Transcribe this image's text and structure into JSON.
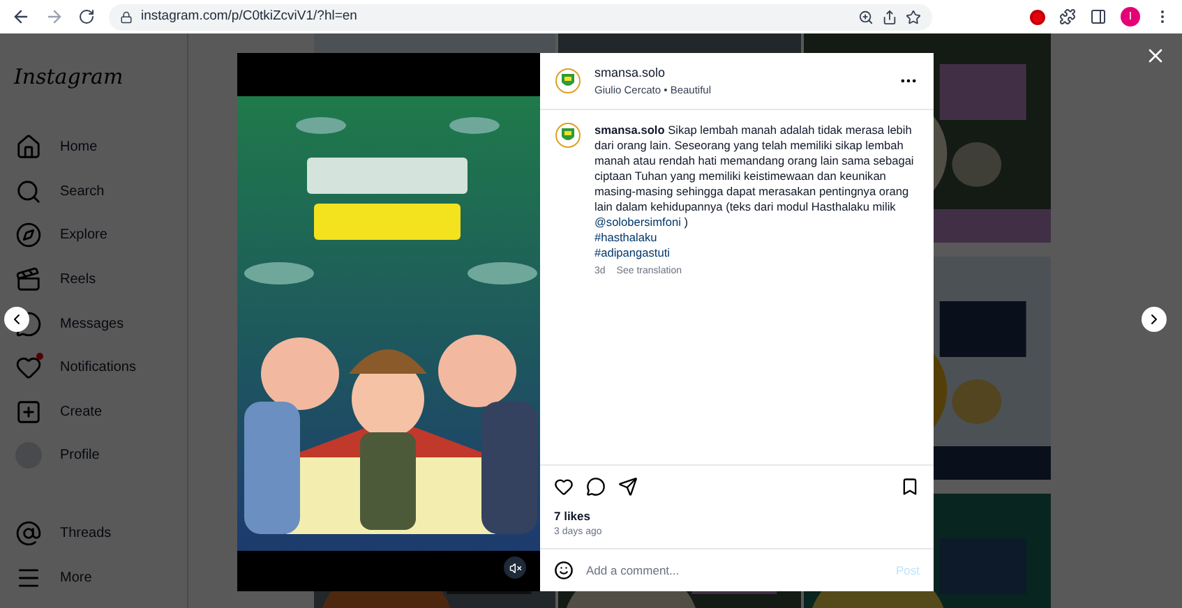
{
  "browser": {
    "url": "instagram.com/p/C0tkiZcviV1/?hl=en",
    "profile_initial": "I"
  },
  "sidebar": {
    "logo": "Instagram",
    "items": [
      {
        "label": "Home",
        "kind": "home",
        "badge": false
      },
      {
        "label": "Search",
        "kind": "search",
        "badge": false
      },
      {
        "label": "Explore",
        "kind": "explore",
        "badge": false
      },
      {
        "label": "Reels",
        "kind": "reels",
        "badge": false
      },
      {
        "label": "Messages",
        "kind": "messages",
        "badge": false
      },
      {
        "label": "Notifications",
        "kind": "notifications",
        "badge": true
      },
      {
        "label": "Create",
        "kind": "create",
        "badge": false
      },
      {
        "label": "Profile",
        "kind": "profile",
        "badge": false
      }
    ],
    "bottom_items": [
      {
        "label": "Threads",
        "kind": "threads",
        "badge": false
      },
      {
        "label": "More",
        "kind": "more",
        "badge": false
      }
    ]
  },
  "post": {
    "media": {
      "kind": "picture",
      "muted": true
    },
    "username": "smansa.solo",
    "audio": "Giulio Cercato • Beautiful",
    "caption": {
      "username": "smansa.solo",
      "text": "Sikap lembah manah adalah tidak merasa lebih dari orang lain. Seseorang yang telah memiliki sikap lembah manah atau rendah hati memandang orang lain sama sebagai ciptaan Tuhan yang memiliki keistimewaan dan keunikan masing-masing sehingga dapat merasakan pentingnya orang lain dalam kehidupannya (teks dari modul Hasthalaku milik",
      "mention": "@solobersimfoni",
      "mention_suffix": " )",
      "hashtags": [
        "#hasthalaku",
        "#adipangastuti"
      ],
      "time": "3d",
      "translate": "See translation"
    },
    "likes": "7 likes",
    "date": "3 days ago",
    "comment": {
      "placeholder": "Add a comment...",
      "post_button": "Post",
      "post_disabled": true
    }
  }
}
